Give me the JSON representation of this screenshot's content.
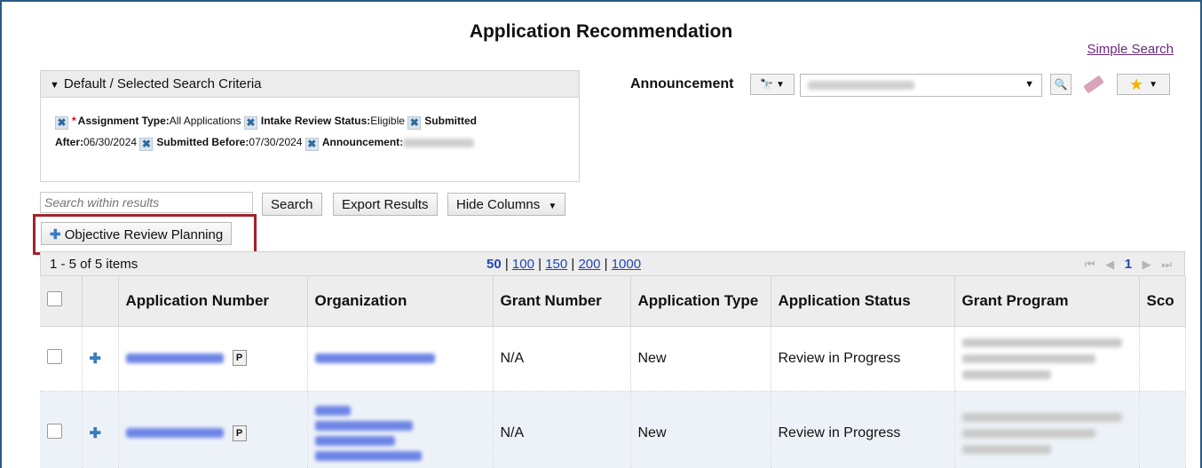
{
  "page": {
    "title": "Application Recommendation",
    "simple_search_link": "Simple Search"
  },
  "criteria": {
    "header": "Default / Selected Search Criteria",
    "items": [
      {
        "label": "Assignment Type:",
        "value": "All Applications",
        "required": true
      },
      {
        "label": "Intake Review Status:",
        "value": "Eligible"
      },
      {
        "label": "Submitted After:",
        "value": "06/30/2024"
      },
      {
        "label": "Submitted Before:",
        "value": "07/30/2024"
      },
      {
        "label": "Announcement:",
        "value": ""
      }
    ]
  },
  "announcement": {
    "label": "Announcement"
  },
  "toolbar": {
    "search_placeholder": "Search within results",
    "search_label": "Search",
    "export_label": "Export Results",
    "hide_columns_label": "Hide Columns",
    "objective_review_label": "Objective Review Planning"
  },
  "grid": {
    "count_text": "1 - 5 of 5 items",
    "page_sizes": [
      "50",
      "100",
      "150",
      "200",
      "1000"
    ],
    "current_page": "1",
    "columns": [
      "Application Number",
      "Organization",
      "Grant Number",
      "Application Type",
      "Application Status",
      "Grant Program",
      "Sco"
    ],
    "rows": [
      {
        "grant_number": "N/A",
        "application_type": "New",
        "application_status": "Review in Progress"
      },
      {
        "grant_number": "N/A",
        "application_type": "New",
        "application_status": "Review in Progress"
      }
    ]
  },
  "colors": {
    "frame_border": "#2b5b84",
    "highlight_border": "#a3232b",
    "link": "#2146b5",
    "row_alt": "#edf2f8"
  }
}
